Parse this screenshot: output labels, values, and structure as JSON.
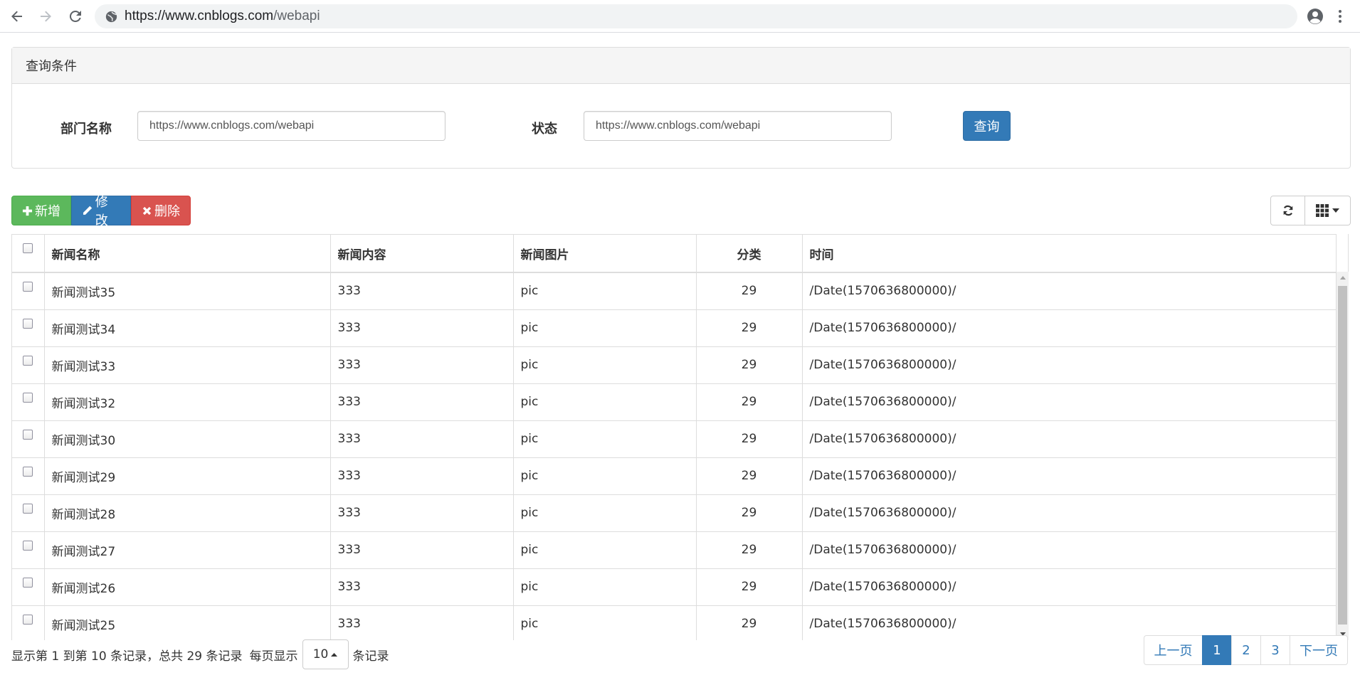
{
  "browser": {
    "url_host": "https://www.cnblogs.com",
    "url_path": "/webapi"
  },
  "query_panel": {
    "heading": "查询条件",
    "dept_label": "部门名称",
    "dept_value": "https://www.cnblogs.com/webapi",
    "status_label": "状态",
    "status_value": "https://www.cnblogs.com/webapi",
    "search_button": "查询"
  },
  "toolbar": {
    "add_label": "新增",
    "edit_label": "修改",
    "delete_label": "删除"
  },
  "table": {
    "columns": [
      "新闻名称",
      "新闻内容",
      "新闻图片",
      "分类",
      "时间"
    ],
    "rows": [
      {
        "name": "新闻测试35",
        "content": "333",
        "pic": "pic",
        "category": "29",
        "time": "/Date(1570636800000)/"
      },
      {
        "name": "新闻测试34",
        "content": "333",
        "pic": "pic",
        "category": "29",
        "time": "/Date(1570636800000)/"
      },
      {
        "name": "新闻测试33",
        "content": "333",
        "pic": "pic",
        "category": "29",
        "time": "/Date(1570636800000)/"
      },
      {
        "name": "新闻测试32",
        "content": "333",
        "pic": "pic",
        "category": "29",
        "time": "/Date(1570636800000)/"
      },
      {
        "name": "新闻测试30",
        "content": "333",
        "pic": "pic",
        "category": "29",
        "time": "/Date(1570636800000)/"
      },
      {
        "name": "新闻测试29",
        "content": "333",
        "pic": "pic",
        "category": "29",
        "time": "/Date(1570636800000)/"
      },
      {
        "name": "新闻测试28",
        "content": "333",
        "pic": "pic",
        "category": "29",
        "time": "/Date(1570636800000)/"
      },
      {
        "name": "新闻测试27",
        "content": "333",
        "pic": "pic",
        "category": "29",
        "time": "/Date(1570636800000)/"
      },
      {
        "name": "新闻测试26",
        "content": "333",
        "pic": "pic",
        "category": "29",
        "time": "/Date(1570636800000)/"
      },
      {
        "name": "新闻测试25",
        "content": "333",
        "pic": "pic",
        "category": "29",
        "time": "/Date(1570636800000)/"
      }
    ]
  },
  "pagination": {
    "info": "显示第 1 到第 10 条记录，总共 29 条记录",
    "per_page_prefix": "每页显示",
    "page_size": "10",
    "per_page_suffix": "条记录",
    "prev_label": "上一页",
    "pages": [
      "1",
      "2",
      "3"
    ],
    "next_label": "下一页"
  },
  "colors": {
    "primary": "#337ab7",
    "success": "#5cb85c",
    "danger": "#d9534f"
  }
}
